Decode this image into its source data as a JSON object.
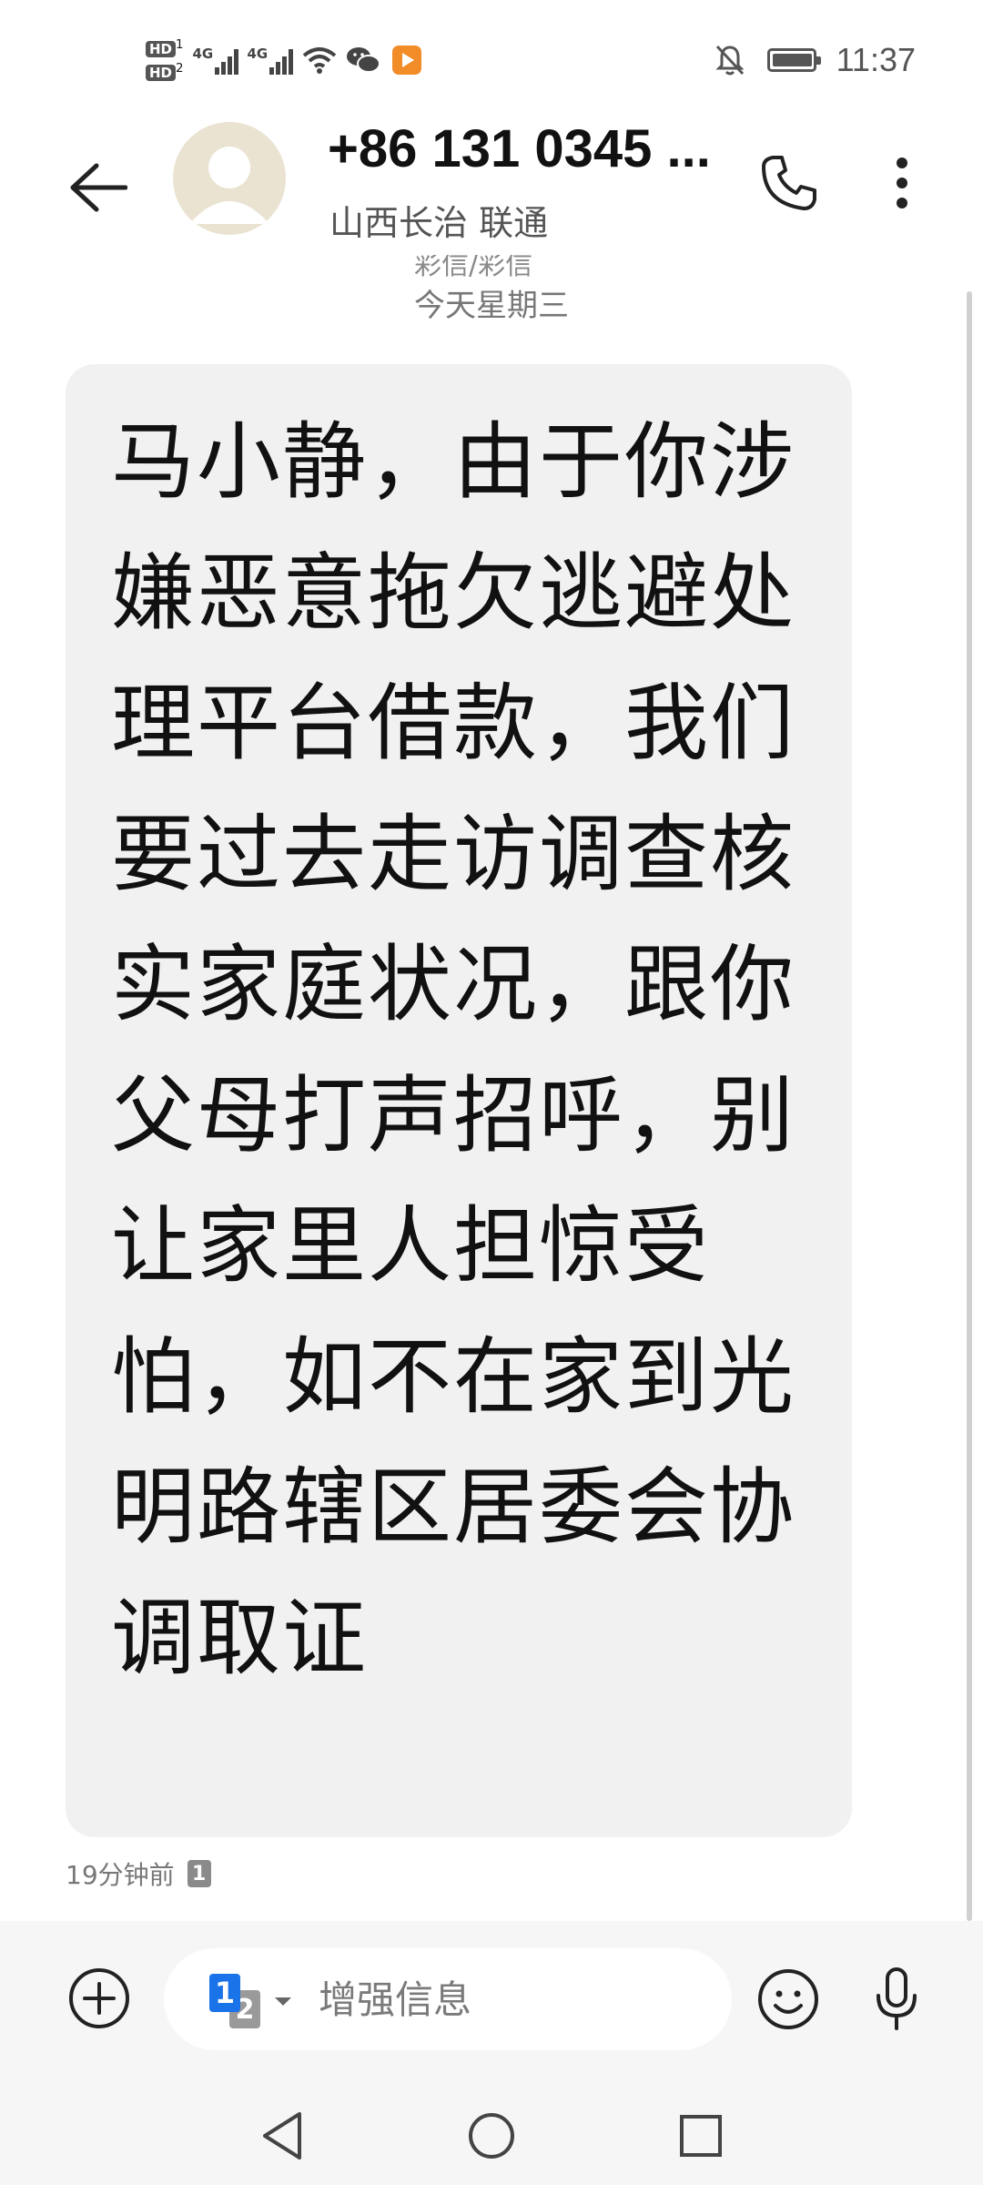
{
  "status_bar": {
    "hd1": "HD",
    "hd1_sub": "1",
    "hd2": "HD",
    "hd2_sub": "2",
    "signal1_label": "4G",
    "signal2_label": "4G",
    "time": "11:37",
    "battery_level": 0.9,
    "icons": [
      "signal-icon",
      "wifi-icon",
      "wechat-icon",
      "video-app-icon",
      "mute-icon",
      "battery-icon"
    ]
  },
  "header": {
    "contact_name": "+86 131 0345 ...",
    "contact_location": "山西长治 联通",
    "icons": [
      "back-arrow-icon",
      "avatar-icon",
      "phone-icon",
      "more-vertical-icon"
    ]
  },
  "conversation": {
    "clipped_text": "彩信/彩信",
    "date_divider": "今天星期三",
    "message": {
      "text": "马小静，由于你涉嫌恶意拖欠逃避处理平台借款，我们要过去走访调查核实家庭状况，跟你父母打声招呼，别让家里人担惊受怕，如不在家到光明路辖区居委会协调取证",
      "time": "19分钟前",
      "sim": "1"
    }
  },
  "composer": {
    "sim_primary": "1",
    "sim_secondary": "2",
    "placeholder": "增强信息",
    "icons": [
      "add-icon",
      "emoji-icon",
      "microphone-icon"
    ]
  },
  "navigation": {
    "icons": [
      "nav-back-icon",
      "nav-home-icon",
      "nav-recents-icon"
    ]
  },
  "colors": {
    "bubble_bg": "#f1f1f1",
    "accent": "#1a73e8",
    "bar_bg": "#f6f6f6"
  }
}
